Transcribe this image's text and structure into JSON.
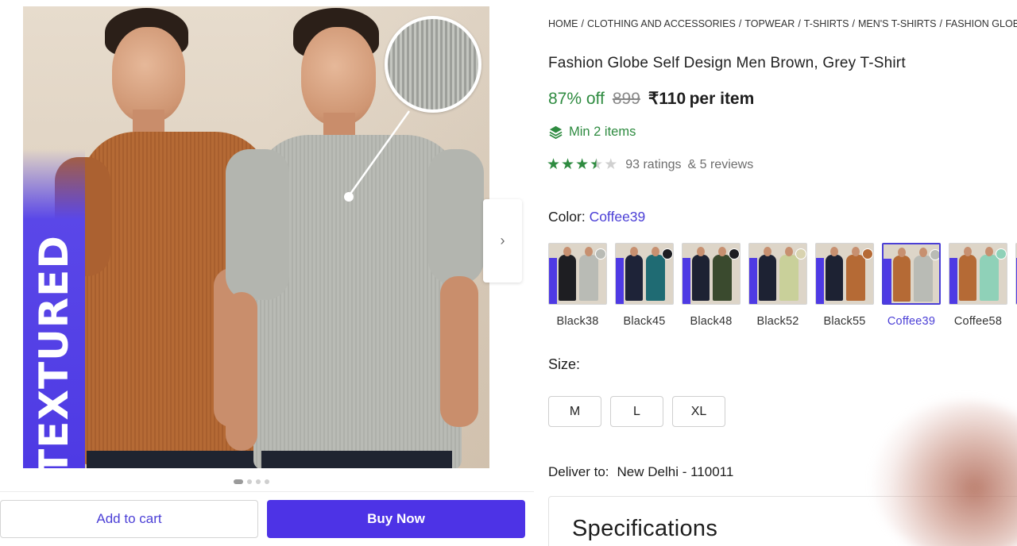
{
  "gallery": {
    "badge_text": "TEXTURED",
    "next_arrow": "›",
    "dots": 4,
    "active_dot": 0
  },
  "actions": {
    "add_to_cart": "Add to cart",
    "buy_now": "Buy Now"
  },
  "breadcrumb": [
    "HOME",
    "/",
    "CLOTHING AND ACCESSORIES",
    "/",
    "TOPWEAR",
    "/",
    "T-SHIRTS",
    "/",
    "MEN'S T-SHIRTS",
    "/",
    "FASHION GLOBE MEN"
  ],
  "product": {
    "title": "Fashion Globe Self Design Men Brown, Grey T-Shirt",
    "discount": "87% off",
    "mrp": "899",
    "price": "₹110",
    "price_unit": "per item",
    "min_items": "Min 2 items",
    "rating_value": 3.5,
    "ratings": "93 ratings",
    "reviews": "& 5 reviews"
  },
  "color": {
    "label": "Color:",
    "selected": "Coffee39",
    "options": [
      {
        "name": "Black38",
        "c1": "#1e1e22",
        "c2": "#b9bbb5",
        "dot": "#b9bbb5"
      },
      {
        "name": "Black45",
        "c1": "#1e2338",
        "c2": "#1f6b73",
        "dot": "#1e1e22"
      },
      {
        "name": "Black48",
        "c1": "#1d2233",
        "c2": "#3a4a2e",
        "dot": "#1e1e22"
      },
      {
        "name": "Black52",
        "c1": "#1d2233",
        "c2": "#c9d09a",
        "dot": "#d9d3b0"
      },
      {
        "name": "Black55",
        "c1": "#1d2233",
        "c2": "#b56a35",
        "dot": "#b56a35"
      },
      {
        "name": "Coffee39",
        "c1": "#b56a35",
        "c2": "#b9bbb5",
        "dot": "#b9bbb5"
      },
      {
        "name": "Coffee58",
        "c1": "#b56a35",
        "c2": "#8fd1b8",
        "dot": "#8fd1b8"
      },
      {
        "name": "",
        "c1": "#4e3ae4",
        "c2": "#4e3ae4",
        "dot": "#4e3ae4"
      }
    ]
  },
  "size": {
    "label": "Size:",
    "options": [
      "M",
      "L",
      "XL"
    ]
  },
  "delivery": {
    "label": "Deliver to:",
    "location": "New Delhi - 110011"
  },
  "specifications": {
    "title": "Specifications"
  },
  "colors": {
    "accent": "#4d33e6",
    "green": "#2e8b40",
    "link": "#4b3fd6"
  }
}
